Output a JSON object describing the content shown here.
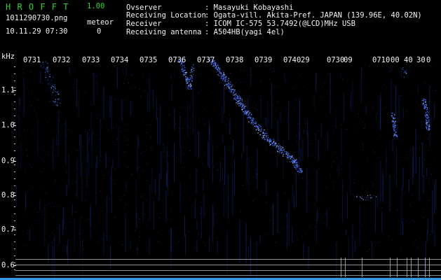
{
  "app": {
    "name": "H R O F F T",
    "version": "1.00",
    "filename": "1011290730.png",
    "datetime": "10.11.29 07:30",
    "meteor_label": "meteor",
    "meteor_count": "0"
  },
  "info": {
    "rows": [
      {
        "label": "Ovserver",
        "value": ": Masayuki Kobayashi"
      },
      {
        "label": "Receiving Location",
        "value": ": Ogata-vill. Akita-Pref. JAPAN (139.96E, 40.02N)"
      },
      {
        "label": "Receiver",
        "value": ": ICOM IC-575 53.7492(@LCD)MHz USB"
      },
      {
        "label": "Receiving antenna",
        "value": ": A504HB(yagi 4el)"
      }
    ]
  },
  "axis": {
    "unit": "kHz",
    "y_ticks": [
      "1.1",
      "1.0",
      "0.9",
      "0.8",
      "0.7",
      "0.6"
    ],
    "x_labels": [
      "0731",
      "0732",
      "0733",
      "0734",
      "0735",
      "0736",
      "0737",
      "0738",
      "0739",
      "0740",
      "29",
      "0730",
      "09",
      "0710",
      "00",
      "40",
      "30",
      "0"
    ]
  },
  "colors": {
    "signal_dim": "#1a2a8a",
    "signal_bright": "#4a7bff",
    "signal_core": "#b8d2ff",
    "header_green": "#2fd12f",
    "axis_white": "#f2f2f2",
    "baseline_cyan": "#3fa9ff"
  }
}
